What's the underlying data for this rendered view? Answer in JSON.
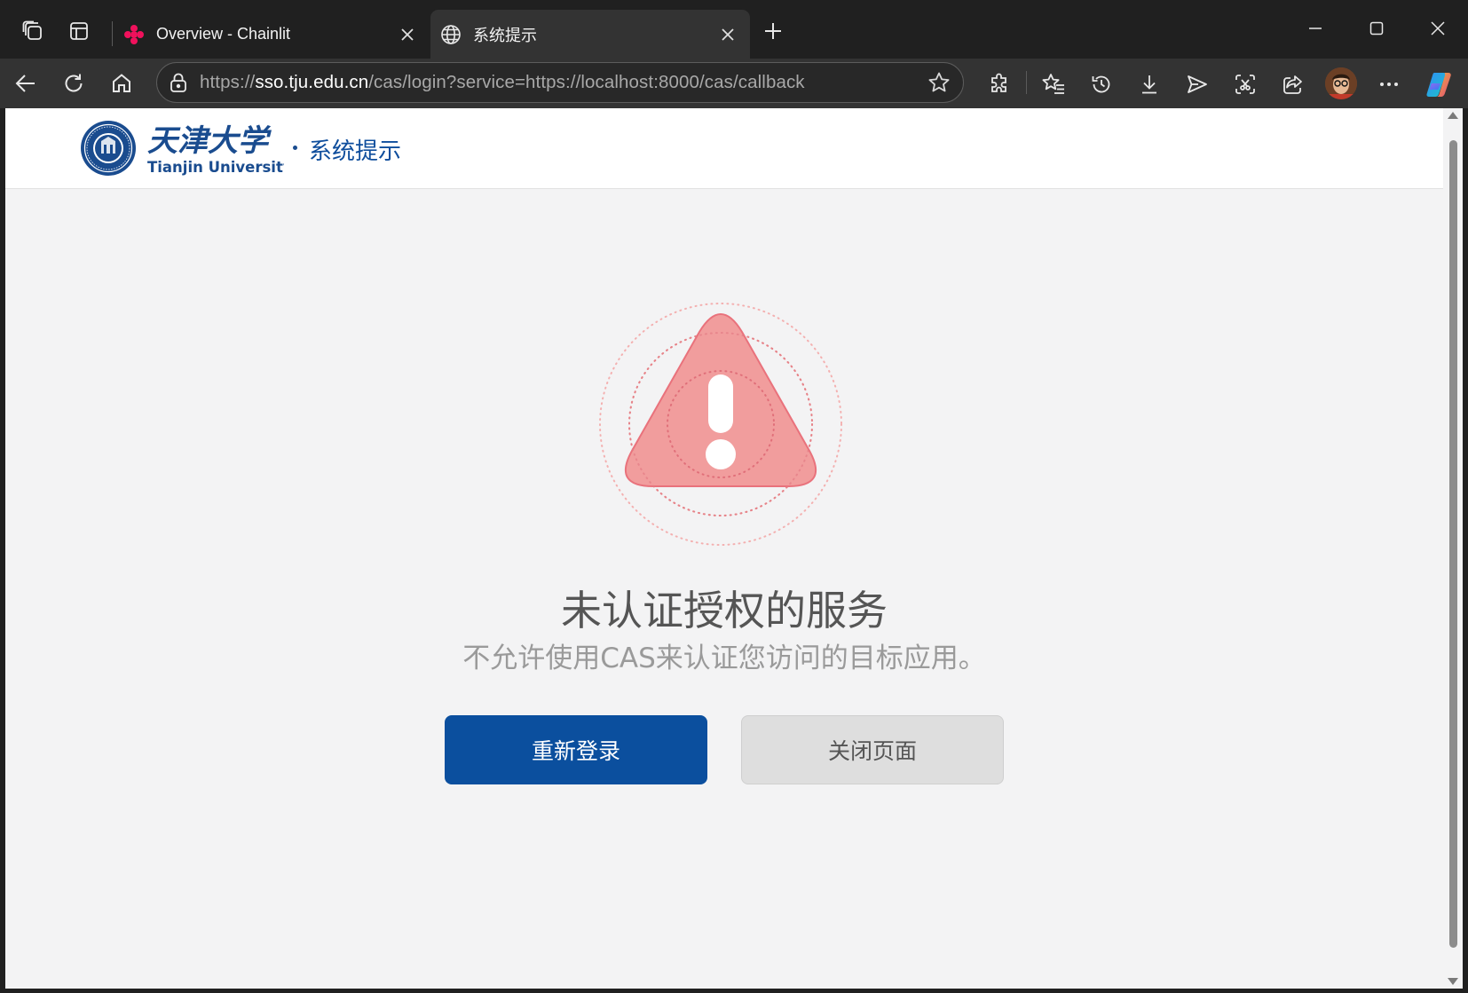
{
  "browser": {
    "tabs": [
      {
        "title": "Overview - Chainlit",
        "active": false,
        "favicon": "chainlit-icon"
      },
      {
        "title": "系统提示",
        "active": true,
        "favicon": "globe-icon"
      }
    ],
    "address_bar": {
      "url_prefix": "https://",
      "url_host": "sso.tju.edu.cn",
      "url_rest": "/cas/login?service=https://localhost:8000/cas/callback"
    }
  },
  "site": {
    "logo_cn": "天津大学",
    "logo_en": "Tianjin University",
    "subtitle": "系统提示"
  },
  "error": {
    "icon": "warning-triangle-icon",
    "title": "未认证授权的服务",
    "description": "不允许使用CAS来认证您访问的目标应用。"
  },
  "actions": {
    "relogin_label": "重新登录",
    "close_label": "关闭页面"
  },
  "colors": {
    "brand_blue": "#0b4f9e",
    "warning_fill": "#f19c9c",
    "warning_stroke": "#e9707a"
  }
}
